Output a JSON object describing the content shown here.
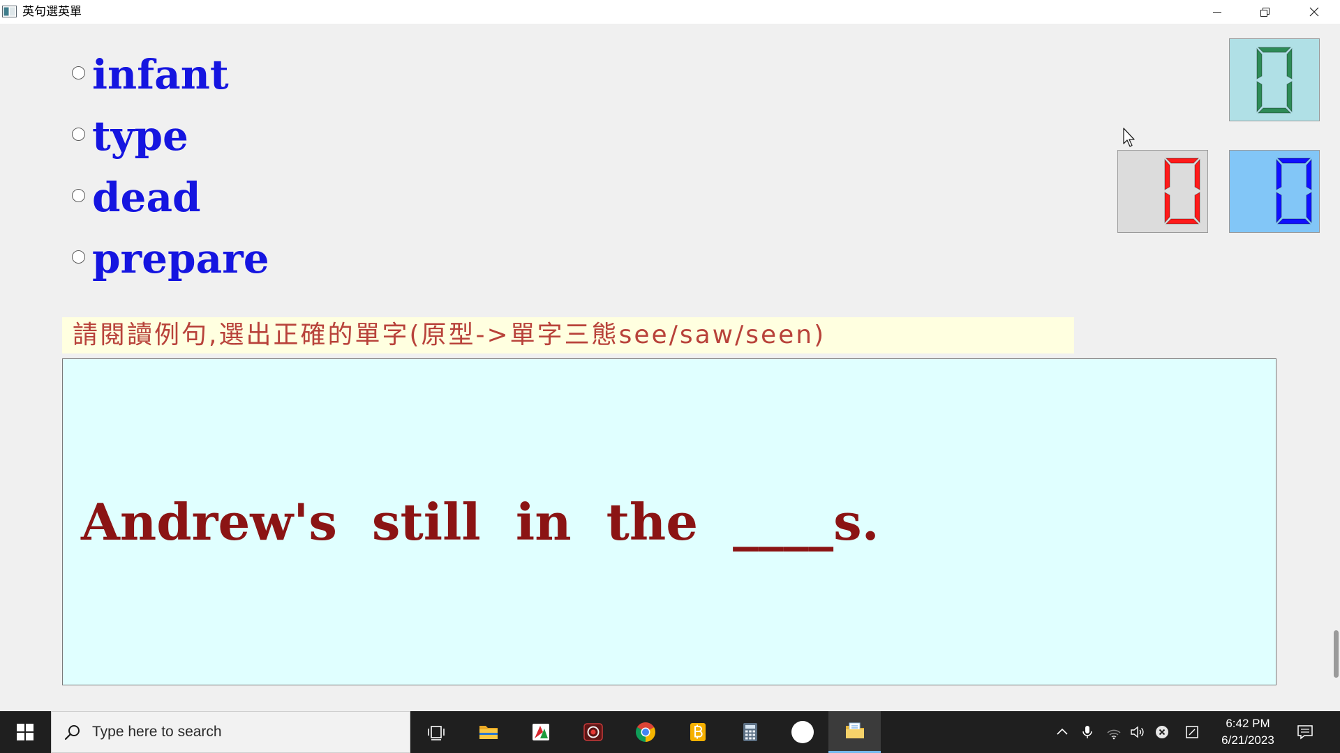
{
  "window": {
    "title": "英句選英單",
    "icon": "app-icon",
    "controls": [
      "minimize-icon",
      "restore-icon",
      "close-icon"
    ]
  },
  "colors": {
    "page_background": "#f0f0f0",
    "option_text": "#1515e0",
    "instruction_text": "#b8423a",
    "instruction_background": "#ffffe0",
    "sentence_text": "#8b1414",
    "sentence_background": "#e0ffff"
  },
  "options": [
    {
      "label": "infant",
      "selected": false
    },
    {
      "label": "type",
      "selected": false
    },
    {
      "label": "dead",
      "selected": false
    },
    {
      "label": "prepare",
      "selected": false
    }
  ],
  "counters": [
    {
      "value": 0,
      "digit_color": "#2e8b57",
      "background": "#b0e0e6"
    },
    {
      "value": 0,
      "digit_color": "#ff1a1a",
      "background": "#dcdcdc"
    },
    {
      "value": 0,
      "digit_color": "#1010ff",
      "background": "#82c6f7"
    }
  ],
  "instruction": "請閱讀例句,選出正確的單字(原型->單字三態see/saw/seen)",
  "sentence": "Andrew's still in the ____s.",
  "taskbar": {
    "start_icon": "windows-logo-icon",
    "search": {
      "icon": "search-icon",
      "placeholder": "Type here to search"
    },
    "apps": [
      {
        "icon": "task-view-icon",
        "active": false
      },
      {
        "icon": "file-explorer-icon",
        "active": false
      },
      {
        "icon": "red-green-app-icon",
        "active": false
      },
      {
        "icon": "screen-recorder-icon",
        "active": false
      },
      {
        "icon": "chrome-icon",
        "active": false
      },
      {
        "icon": "yellow-app-icon",
        "active": false
      },
      {
        "icon": "calculator-icon",
        "active": false
      },
      {
        "icon": "white-circle-app-icon",
        "active": false
      },
      {
        "icon": "folder-app-icon",
        "active": true
      }
    ],
    "tray_icons": [
      "chevron-up-icon",
      "microphone-icon",
      "network-icon",
      "volume-icon",
      "error-icon",
      "tablet-icon"
    ],
    "clock": {
      "time": "6:42 PM",
      "date": "6/21/2023"
    },
    "notification_icon": "notification-icon"
  }
}
